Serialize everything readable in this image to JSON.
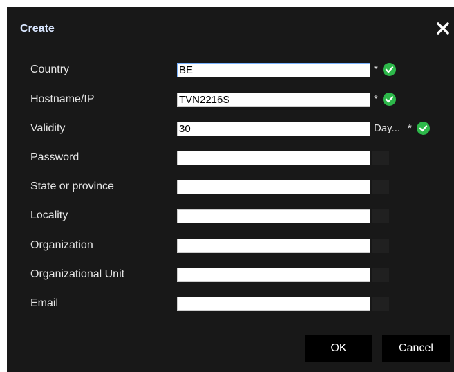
{
  "dialog": {
    "title": "Create",
    "close_icon": "close-icon"
  },
  "fields": {
    "country": {
      "label": "Country",
      "value": "BE",
      "required_mark": "*"
    },
    "hostname": {
      "label": "Hostname/IP",
      "value": "TVN2216S",
      "required_mark": "*"
    },
    "validity": {
      "label": "Validity",
      "value": "30",
      "unit": "Day...",
      "required_mark": "*"
    },
    "password": {
      "label": "Password",
      "value": ""
    },
    "state": {
      "label": "State or province",
      "value": ""
    },
    "locality": {
      "label": "Locality",
      "value": ""
    },
    "organization": {
      "label": "Organization",
      "value": ""
    },
    "org_unit": {
      "label": "Organizational Unit",
      "value": ""
    },
    "email": {
      "label": "Email",
      "value": ""
    }
  },
  "buttons": {
    "ok": "OK",
    "cancel": "Cancel"
  },
  "colors": {
    "dialog_bg": "#181818",
    "title": "#d9e6ff",
    "valid_check": "#2db84a"
  }
}
